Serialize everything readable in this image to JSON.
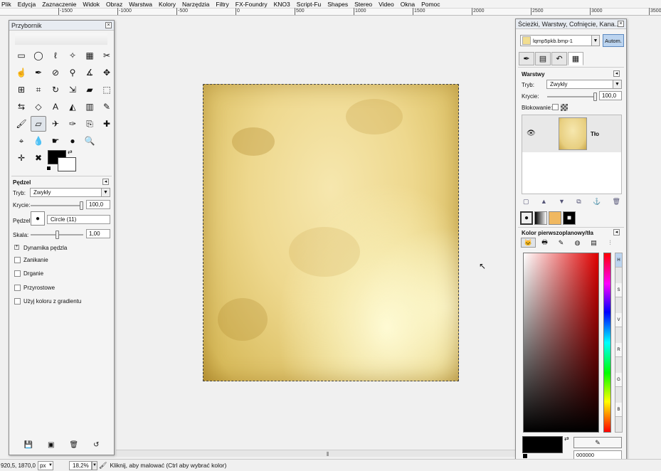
{
  "menu": [
    "Plik",
    "Edycja",
    "Zaznaczenie",
    "Widok",
    "Obraz",
    "Warstwa",
    "Kolory",
    "Narzędzia",
    "Filtry",
    "FX-Foundry",
    "KNO3",
    "Script-Fu",
    "Shapes",
    "Stereo",
    "Video",
    "Okna",
    "Pomoc"
  ],
  "ruler": {
    "ticks": [
      "-1500",
      "-1000",
      "-500",
      "0",
      "500",
      "1000",
      "1500",
      "2000",
      "2500",
      "3000",
      "3500"
    ]
  },
  "toolbox": {
    "title": "Przybornik",
    "tools": [
      [
        "rect-select-icon",
        "▭"
      ],
      [
        "ellipse-select-icon",
        "◯"
      ],
      [
        "lasso-icon",
        "ℓ"
      ],
      [
        "magic-wand-icon",
        "✧"
      ],
      [
        "select-by-color-icon",
        "▦"
      ],
      [
        "scissors-icon",
        "✂"
      ],
      [
        "foreground-select-icon",
        "☝"
      ],
      [
        "paths-icon",
        "✒"
      ],
      [
        "color-picker-icon",
        "⊘"
      ],
      [
        "zoom-tool-icon",
        "⚲"
      ],
      [
        "measure-icon",
        "∡"
      ],
      [
        "move-icon",
        "✥"
      ],
      [
        "align-icon",
        "⊞"
      ],
      [
        "crop-icon",
        "⌗"
      ],
      [
        "rotate-icon",
        "↻"
      ],
      [
        "scale-icon",
        "⇲"
      ],
      [
        "shear-icon",
        "▰"
      ],
      [
        "perspective-icon",
        "⬚"
      ],
      [
        "flip-icon",
        "⇆"
      ],
      [
        "cage-icon",
        "◇"
      ],
      [
        "text-tool-icon",
        "A"
      ],
      [
        "bucket-fill-icon",
        "◭"
      ],
      [
        "blend-icon",
        "▥"
      ],
      [
        "pencil-icon",
        "✎"
      ],
      [
        "paintbrush-icon",
        "🖌"
      ],
      [
        "eraser-icon",
        "▱"
      ],
      [
        "airbrush-icon",
        "✈"
      ],
      [
        "ink-icon",
        "✑"
      ],
      [
        "clone-icon",
        "⎘"
      ],
      [
        "heal-icon",
        "✚"
      ],
      [
        "perspective-clone-icon",
        "⌖"
      ],
      [
        "blur-icon",
        "💧"
      ],
      [
        "smudge-icon",
        "☛"
      ],
      [
        "dodge-burn-icon",
        "●"
      ],
      [
        "magnify-icon",
        "🔍"
      ],
      [
        "empty-1",
        ""
      ],
      [
        "move-arrows-icon",
        "✛"
      ],
      [
        "heal-cross-icon",
        "✖"
      ],
      [
        "empty-2",
        ""
      ],
      [
        "empty-3",
        ""
      ],
      [
        "empty-4",
        ""
      ],
      [
        "empty-5",
        ""
      ]
    ],
    "active_tool_index": 25,
    "options": {
      "section_title": "Pędzel",
      "mode_label": "Tryb:",
      "mode_value": "Zwykły",
      "opacity_label": "Krycie:",
      "opacity_value": "100,0",
      "opacity_fraction": 1.0,
      "brush_label": "Pędzel:",
      "brush_value": "Circle (11)",
      "scale_label": "Skala:",
      "scale_value": "1,00",
      "scale_fraction": 0.5,
      "dynamics_label": "Dynamika pędzla",
      "checkboxes": [
        "Zanikanie",
        "Drganie",
        "Przyrostowe",
        "Użyj koloru z gradientu"
      ]
    }
  },
  "layers_dock": {
    "title": "Ścieżki, Warstwy, Cofnięcie, Kana...",
    "image_name": "lqmp5pkb.bmp-1",
    "auto_button": "Autom.",
    "section_title": "Warstwy",
    "mode_label": "Tryb:",
    "mode_value": "Zwykły",
    "opacity_label": "Krycie:",
    "opacity_value": "100,0",
    "opacity_fraction": 1.0,
    "lock_label": "Blokowanie:",
    "layer_name": "Tło",
    "color_section_title": "Kolor pierwszoplanowy/tła",
    "channels": [
      "H",
      "S",
      "V",
      "R",
      "G",
      "B"
    ],
    "hex_value": "000000",
    "fg_color": "#000000",
    "bg_color": "#ffffff"
  },
  "status": {
    "coords": "920,5, 1870,0",
    "unit": "px",
    "zoom": "18,2%",
    "message": "Kliknij, aby malować (Ctrl aby wybrać kolor)"
  }
}
